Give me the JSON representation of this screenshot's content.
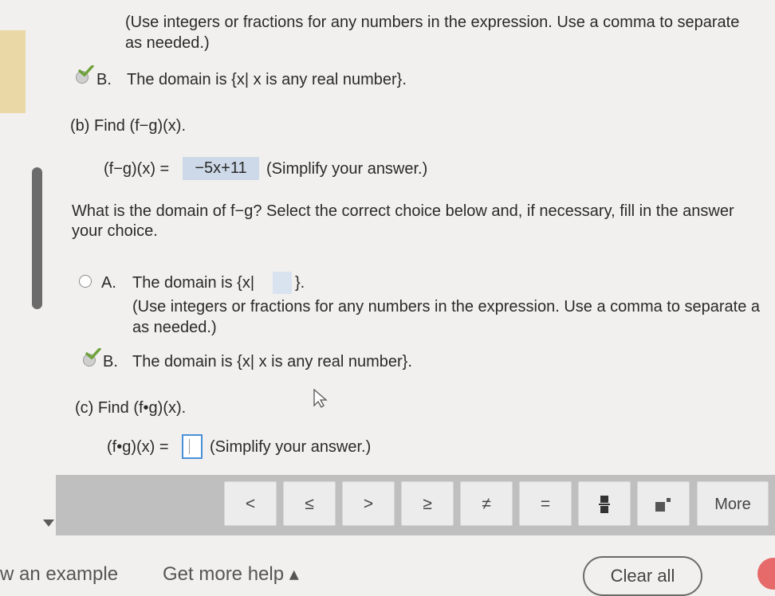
{
  "part_a": {
    "instruction_line1": "(Use integers or fractions for any numbers in the expression. Use a comma to separate",
    "instruction_line2": "as needed.)",
    "choice_b_letter": "B.",
    "choice_b_text": "The domain is {x| x is any real number}."
  },
  "part_b": {
    "prompt": "(b) Find (f−g)(x).",
    "expr_label": "(f−g)(x) =",
    "answer": "−5x+11",
    "hint": "(Simplify your answer.)",
    "domain_question_line1": "What is the domain of f−g? Select the correct choice below and, if necessary, fill in the answer",
    "domain_question_line2": "your choice.",
    "choice_a_letter": "A.",
    "choice_a_text_pre": "The domain is {x|",
    "choice_a_text_post": "}.",
    "choice_a_instruction_line1": "(Use integers or fractions for any numbers in the expression. Use a comma to separate a",
    "choice_a_instruction_line2": "as needed.)",
    "choice_b_letter": "B.",
    "choice_b_text": "The domain is {x| x is any real number}."
  },
  "part_c": {
    "prompt": "(c) Find (f•g)(x).",
    "expr_label": "(f•g)(x) =",
    "hint": "(Simplify your answer.)"
  },
  "toolbar": {
    "buttons": [
      "<",
      "≤",
      ">",
      "≥",
      "≠",
      "=",
      "▪",
      "▪˙",
      "More"
    ]
  },
  "footer": {
    "view_example": "w an example",
    "get_more_help": "Get more help ▴",
    "clear_all": "Clear all"
  },
  "colors": {
    "answer_highlight": "#cdd9e8",
    "check_green": "#6fa23a",
    "input_border": "#4a90d9"
  }
}
